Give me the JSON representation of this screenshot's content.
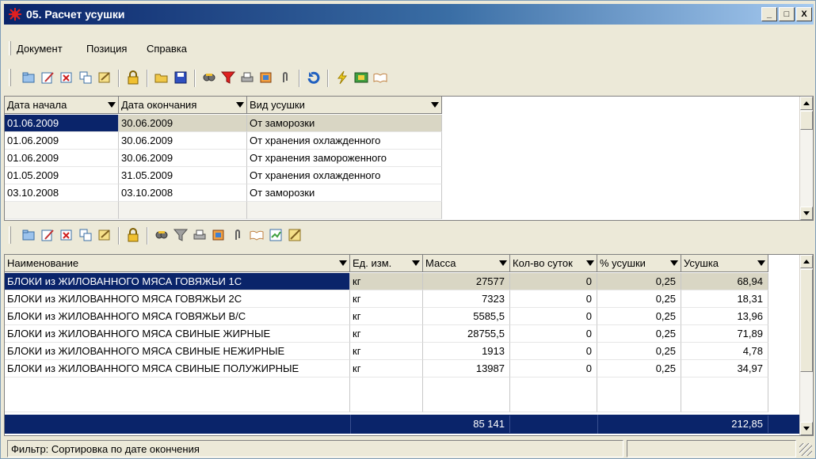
{
  "window": {
    "title": "05. Расчет усушки",
    "min_label": "_",
    "max_label": "□",
    "close_label": "X"
  },
  "menu": {
    "items": [
      "Документ",
      "Позиция",
      "Справка"
    ]
  },
  "top_grid": {
    "columns": [
      "Дата начала",
      "Дата окончания",
      "Вид усушки"
    ],
    "rows": [
      [
        "01.06.2009",
        "30.06.2009",
        "От заморозки"
      ],
      [
        "01.06.2009",
        "30.06.2009",
        "От хранения охлажденного"
      ],
      [
        "01.06.2009",
        "30.06.2009",
        "От хранения замороженного"
      ],
      [
        "01.05.2009",
        "31.05.2009",
        "От хранения охлажденного"
      ],
      [
        "03.10.2008",
        "03.10.2008",
        "От заморозки"
      ]
    ]
  },
  "bottom_grid": {
    "columns": [
      "Наименование",
      "Ед. изм.",
      "Масса",
      "Кол-во суток",
      "% усушки",
      "Усушка"
    ],
    "rows": [
      [
        "БЛОКИ из ЖИЛОВАННОГО МЯСА ГОВЯЖЬИ 1С",
        "кг",
        "27577",
        "0",
        "0,25",
        "68,94"
      ],
      [
        "БЛОКИ из ЖИЛОВАННОГО МЯСА ГОВЯЖЬИ 2С",
        "кг",
        "7323",
        "0",
        "0,25",
        "18,31"
      ],
      [
        "БЛОКИ из ЖИЛОВАННОГО МЯСА ГОВЯЖЬИ В/С",
        "кг",
        "5585,5",
        "0",
        "0,25",
        "13,96"
      ],
      [
        "БЛОКИ из ЖИЛОВАННОГО МЯСА СВИНЫЕ  ЖИРНЫЕ",
        "кг",
        "28755,5",
        "0",
        "0,25",
        "71,89"
      ],
      [
        "БЛОКИ из ЖИЛОВАННОГО МЯСА СВИНЫЕ  НЕЖИРНЫЕ",
        "кг",
        "1913",
        "0",
        "0,25",
        "4,78"
      ],
      [
        "БЛОКИ из ЖИЛОВАННОГО МЯСА СВИНЫЕ ПОЛУЖИРНЫЕ",
        "кг",
        "13987",
        "0",
        "0,25",
        "34,97"
      ]
    ],
    "totals": {
      "mass": "85 141",
      "shrinkage": "212,85"
    }
  },
  "status": {
    "filter_text": "Фильтр: Сортировка по дате окончения"
  },
  "colors": {
    "selection": "#0a246a",
    "title_gradient_start": "#0a246a",
    "title_gradient_end": "#a6caf0",
    "row_highlight": "#d9d6c4"
  }
}
